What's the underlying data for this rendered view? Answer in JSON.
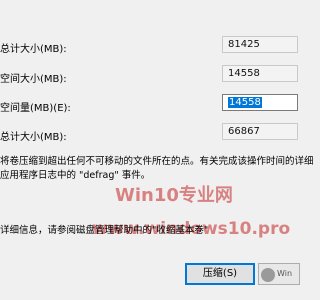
{
  "rows": [
    {
      "label": "总计大小(MB):",
      "value": "81425"
    },
    {
      "label": "空间大小(MB):",
      "value": "14558"
    },
    {
      "label": "空间量(MB)(E):",
      "value": "14558"
    },
    {
      "label": "总计大小(MB):",
      "value": "66867"
    }
  ],
  "note_line1": "将卷压缩到超出任何不可移动的文件所在的点。有关完成该操作时间的详细",
  "note_line2": "应用程序日志中的 \"defrag\" 事件。",
  "help_text": "详细信息，请参阅磁盘管理帮助中的\"收缩基本卷\"",
  "watermark": {
    "line1": "Win10专业网",
    "line2": "www.windows10.pro",
    "badge": "Win"
  },
  "buttons": {
    "shrink": "压缩(S)"
  },
  "colors": {
    "selection": "#0078d7",
    "watermark": "#c62828"
  }
}
